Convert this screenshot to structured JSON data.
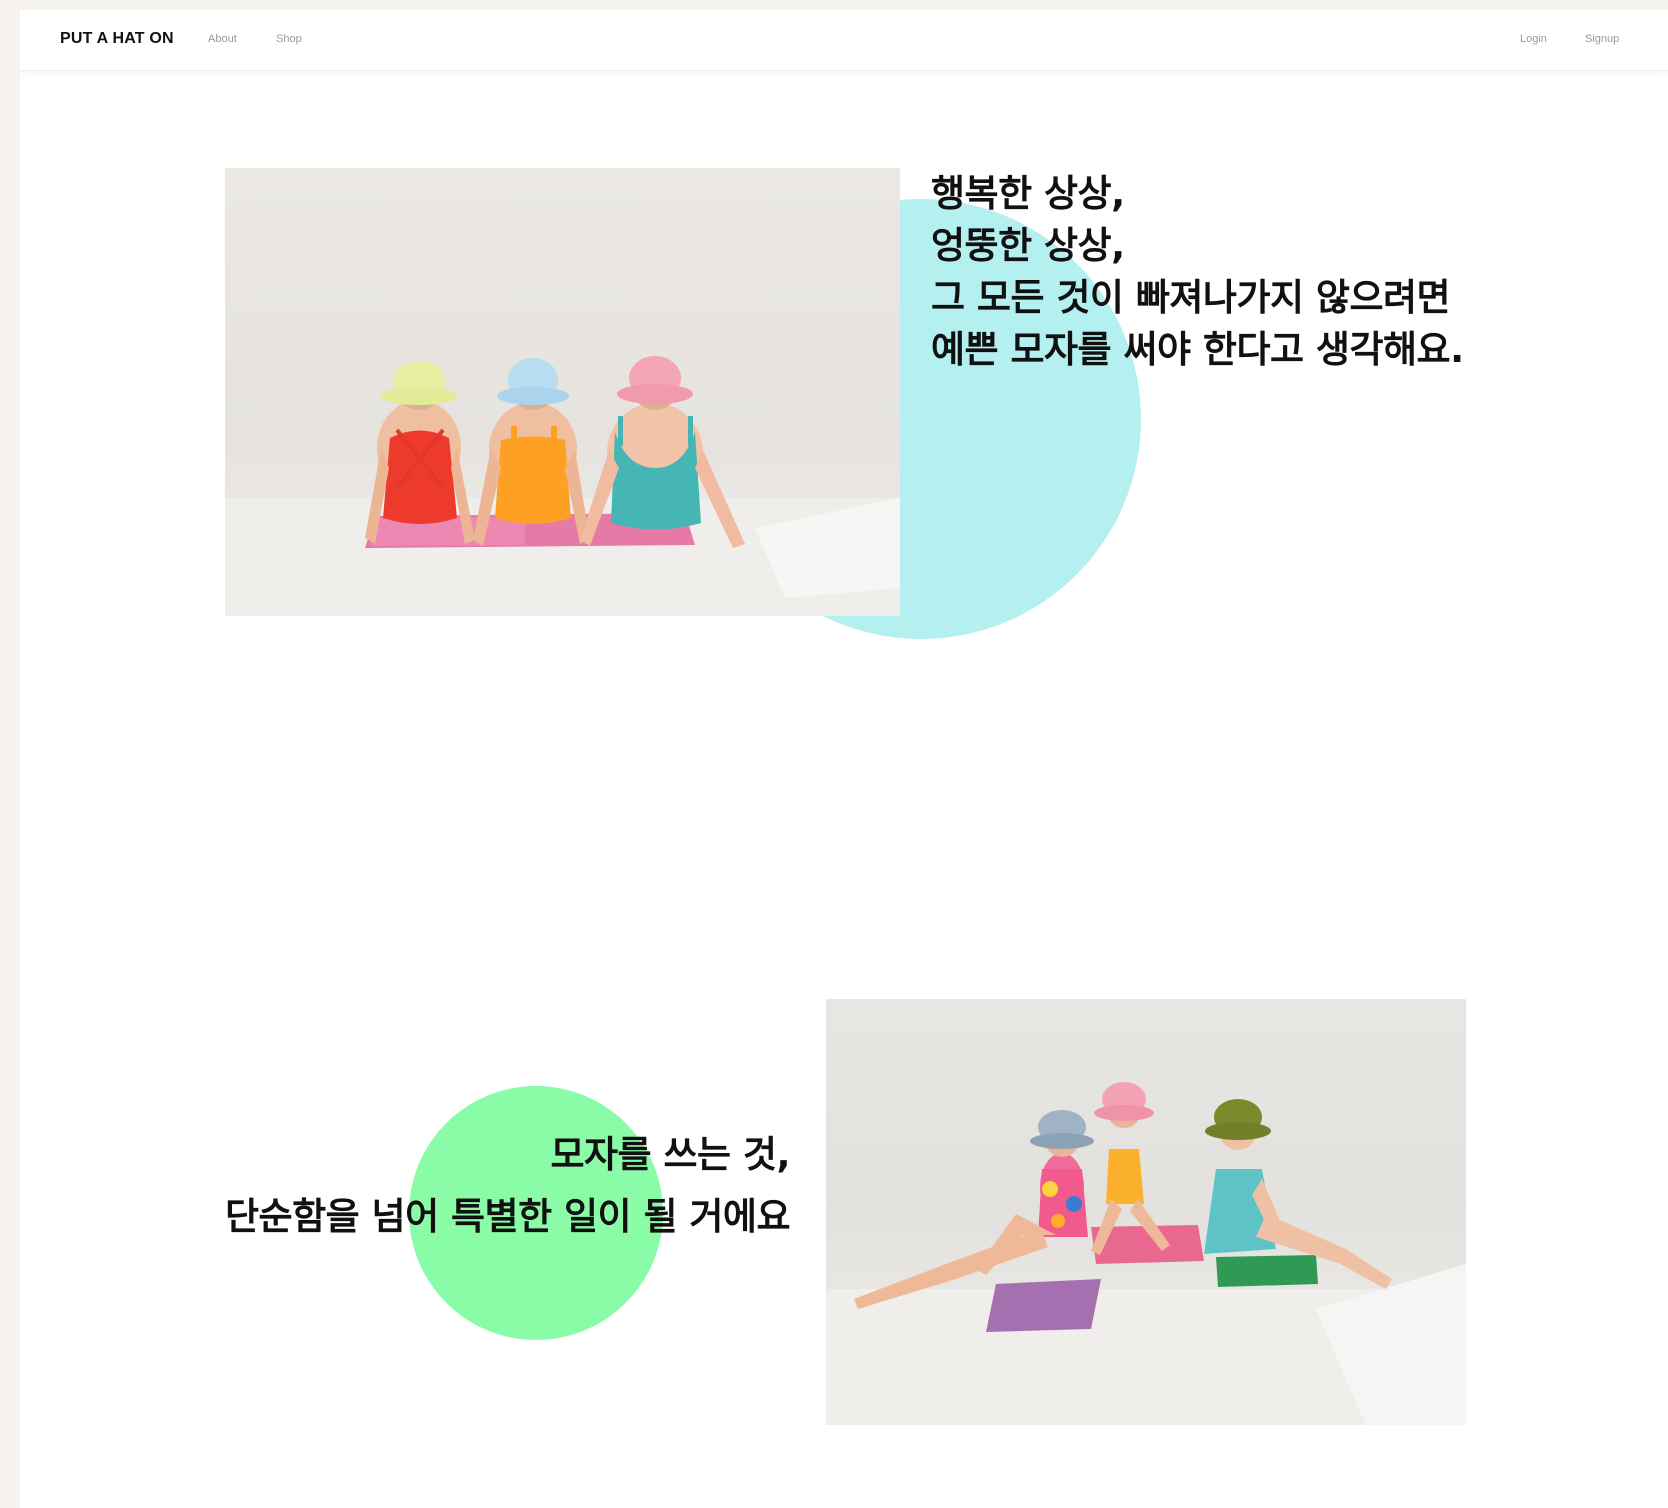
{
  "nav": {
    "brand": "PUT A HAT ON",
    "about": "About",
    "shop": "Shop",
    "login": "Login",
    "signup": "Signup"
  },
  "section1": {
    "lines": [
      "행복한 상상,",
      "엉뚱한 상상,",
      "그 모든 것이 빠져나가지 않으려면",
      "예쁜 모자를 써야 한다고 생각해요."
    ],
    "accent_color": "#b3f0ef"
  },
  "section2": {
    "lines": [
      "모자를 쓰는 것,",
      "단순함을 넘어 특별한 일이 될 거에요"
    ],
    "accent_color": "#8afca8"
  }
}
